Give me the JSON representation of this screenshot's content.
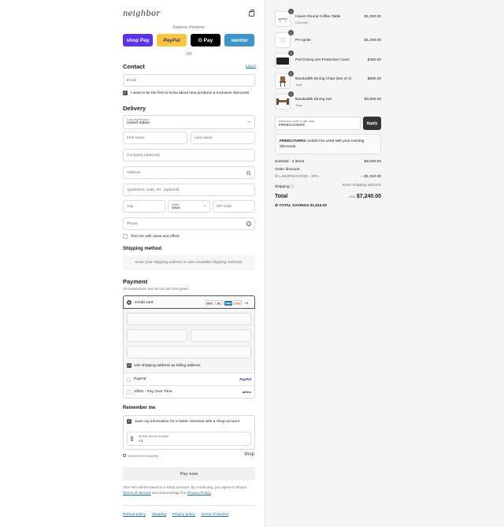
{
  "brand": {
    "logo_text": "neighbor"
  },
  "express": {
    "label": "Express checkout",
    "buttons": [
      {
        "label": "shop Pay",
        "color": "#5a31f4"
      },
      {
        "label": "PayPal",
        "color": "#ffc439"
      },
      {
        "label": "G Pay",
        "color": "#000000"
      },
      {
        "label": "venmo",
        "color": "#3d95ce"
      }
    ],
    "or_label": "OR"
  },
  "contact": {
    "heading": "Contact",
    "login_link": "Log in",
    "email_placeholder": "Email",
    "newsletter_label": "I want to be the first to know about new products & exclusive discounts",
    "newsletter_checked": true
  },
  "delivery": {
    "heading": "Delivery",
    "country_label": "Country/Region",
    "country_value": "United States",
    "first_name": "First name",
    "last_name": "Last name",
    "company": "Company (optional)",
    "address": "Address",
    "apartment": "Apartment, suite, etc. (optional)",
    "city": "City",
    "state_label": "State",
    "state_value": "Iowa",
    "zip": "ZIP code",
    "phone": "Phone",
    "text_me_label": "Text me with news and offers"
  },
  "shipping_method": {
    "heading": "Shipping method",
    "message": "Enter your shipping address to view available shipping methods."
  },
  "payment": {
    "heading": "Payment",
    "subtitle": "All transactions are secure and encrypted.",
    "credit_card_label": "Credit card",
    "card_brands": [
      "VISA",
      "MC",
      "AMEX",
      "DISC"
    ],
    "more_cards": "+4",
    "billing_same_label": "Use shipping address as billing address",
    "paypal_label": "PayPal",
    "paypal_logo": "PayPal",
    "affirm_label": "Affirm - Pay Over Time",
    "affirm_logo": "affirm"
  },
  "remember": {
    "heading": "Remember me",
    "save_label": "Save my information for a faster checkout with a Shop account",
    "mobile_label": "Mobile phone number",
    "mobile_value": "+1",
    "secure_label": "Secure and encrypted",
    "shop_logo": "shop"
  },
  "pay_now_label": "Pay now",
  "legal": {
    "text_1": "Your info will be saved to a Shop account. By continuing, you agree to Shop's",
    "terms_link": "Terms of Service",
    "text_2": "and acknowledge the",
    "privacy_link": "Privacy Policy",
    "text_3": "."
  },
  "footer_links": [
    "Refund policy",
    "Shipping",
    "Privacy policy",
    "Terms of service"
  ],
  "cart": {
    "items": [
      {
        "qty": "1",
        "name": "Haven Round Coffee Table",
        "variant": "Concrete",
        "price": "$1,000.00"
      },
      {
        "qty": "1",
        "name": "PH Ignite",
        "variant": "",
        "price": "$1,200.00"
      },
      {
        "qty": "1",
        "name": "Perf Dining Set Protective Cover",
        "variant": "",
        "price": "$450.00"
      },
      {
        "qty": "2",
        "name": "Bandwidth Dining Chair (Set of 2)",
        "variant": "Teak",
        "price": "$900.00"
      },
      {
        "qty": "1",
        "name": "Bandwidth Dining Set",
        "variant": "Teak",
        "price": "$5,500.00"
      }
    ],
    "discount_label": "Discount code or gift card",
    "discount_value": "FREECOVERS",
    "apply_label": "Apply",
    "error_code": "FREECOVERS",
    "error_text": "couldn't be used with your existing discounts.",
    "subtotal_label": "Subtotal · 5 items",
    "subtotal_value": "$9,050.00",
    "order_discount_label": "Order discount",
    "discount_code_line": "LABORDAY2025 - 20%",
    "discount_amount": "– $1,810.00",
    "shipping_label": "Shipping",
    "shipping_value": "Enter shipping address",
    "total_label": "Total",
    "currency": "USD",
    "total_value": "$7,240.00",
    "savings_label": "TOTAL SAVINGS",
    "savings_value": "$1,810.00"
  }
}
